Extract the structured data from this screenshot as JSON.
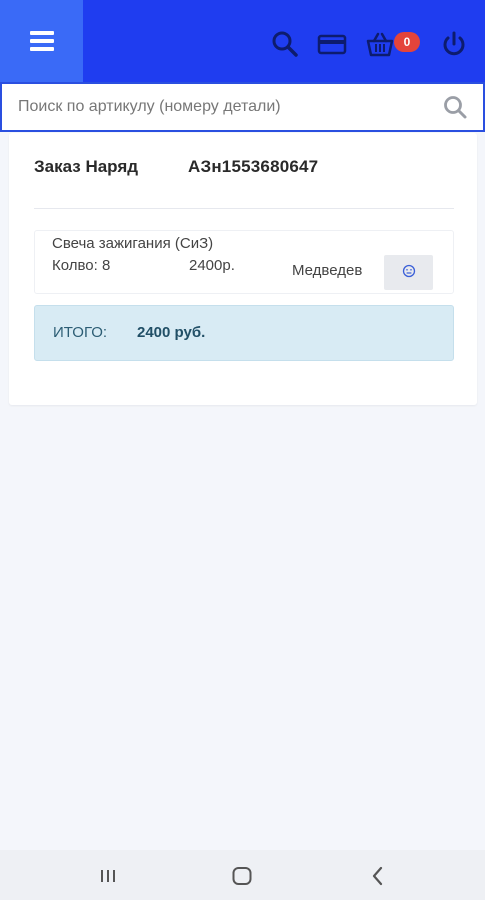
{
  "header": {
    "badge_count": "0",
    "icons": [
      "menu-icon",
      "search-icon",
      "credit-card-icon",
      "basket-icon",
      "power-icon"
    ],
    "colors": {
      "bar": "#1f3df0",
      "menu_bg": "#3a6af7",
      "badge": "#e4443b"
    }
  },
  "search": {
    "placeholder": "Поиск по артикулу (номеру детали)",
    "value": ""
  },
  "order": {
    "title": "Заказ Наряд",
    "number": "АЗн1553680647",
    "items": [
      {
        "name": "Свеча зажигания (СиЗ)",
        "qty": "Колво: 8",
        "price": "2400р.",
        "person": "Медведев",
        "action_icon": "smiley-icon"
      }
    ],
    "total_label": "ИТОГО:",
    "total_value": "2400 руб."
  },
  "navbar": {
    "buttons": [
      "recent-apps-icon",
      "home-icon",
      "back-icon"
    ]
  }
}
